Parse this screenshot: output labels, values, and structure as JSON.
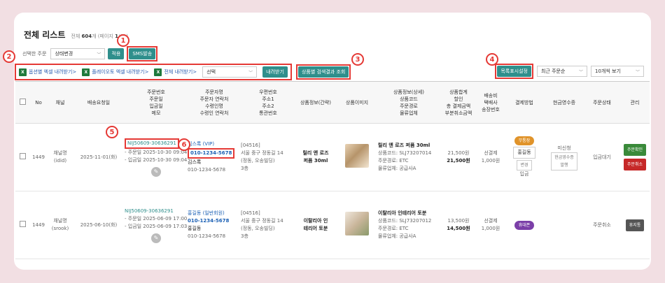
{
  "header": {
    "title": "전체 리스트",
    "count_prefix": "전체",
    "count_total": "604",
    "count_suffix": "개 (페이지",
    "page_current": "1",
    "page_total": "/61)"
  },
  "toolbar": {
    "select_label": "선택한 주문",
    "status_select": "상태변경",
    "apply_label": "적용",
    "sms_label": "SMS발송",
    "export_option": "옵션별 엑셀 내려받기>",
    "export_playauto": "플레이오토 엑셀 내려받기>",
    "export_all": "전체 내려받기>",
    "choose_select": "선택",
    "download_label": "내려받기",
    "search_result_label": "상품별 검색결과 조회",
    "list_settings_label": "목록표시설정",
    "sort_select": "최근 주문순",
    "view_select": "10개씩 보기"
  },
  "markers": [
    "1",
    "2",
    "3",
    "4",
    "5",
    "6"
  ],
  "columns": [
    "No",
    "채널",
    "배송요청일",
    "주문번호\n주문일\n입금일\n메모",
    "주문자명\n주문자 연락처\n수령인명\n수령인 연락처",
    "우편번호\n주소1\n주소2\n통관번호",
    "상품정보(간략)",
    "상품이미지",
    "상품정보(상세)\n상품코드\n주문경로\n물류업체",
    "상품합계\n할인\n총 결제금액\n부분취소금액",
    "배송비\n택배사\n송장번호",
    "결제방법",
    "현금영수증",
    "주문상태",
    "관리"
  ],
  "rows": [
    {
      "no": "1449",
      "channel": "채널명",
      "channel_id": "(idid)",
      "delivery_date": "2025-11-01(화)",
      "order_no": "NIJ50609-30636291",
      "order_date": "- 주문일 2025-10-30 09:04",
      "paid_date": "- 입금일 2025-10-30 09:04",
      "orderer": "김스록",
      "orderer_grade": "(VIP)",
      "orderer_phone": "010-1234-5678",
      "receiver": "김스록",
      "receiver_phone": "010-1234-5678",
      "zip": "[04516]",
      "addr1": "서울 중구 정동길 14",
      "addr2": "(정동, 오송빌딩)",
      "addr3": "3층",
      "product_brief": "릴리 앤 로즈\n퍼퓸 30ml",
      "product_name": "릴리 앤 로즈 퍼퓸 30ml",
      "product_code": "상품코드: SLJ73207014",
      "order_route": "주문경로: ETC",
      "logistics": "물류업체: 공급사A",
      "sum": "21,500원",
      "total": "21,500원",
      "ship_type": "선결제",
      "ship_fee": "1,000원",
      "pay_badge": "무통장",
      "pay_name": "홍길동",
      "pay_change": "변경",
      "pay_status": "입금",
      "receipt_status": "미신청",
      "receipt_btn": "현금영수증\n발행",
      "order_status": "입금대기",
      "action1": "주문확인",
      "action2": "주문취소"
    },
    {
      "no": "1449",
      "channel": "채널명",
      "channel_id": "(srook)",
      "delivery_date": "2025-06-10(화)",
      "order_no": "NIJ50609-30636291",
      "order_date": "- 주문일 2025-06-09 17:00",
      "paid_date": "- 입금일 2025-06-09 17:03",
      "orderer": "홍길동",
      "orderer_grade": "(일반회원)",
      "orderer_phone": "010-1234-5678",
      "receiver": "홍길동",
      "receiver_phone": "010-1234-5678",
      "zip": "[04516]",
      "addr1": "서울 중구 정동길 14",
      "addr2": "(정동, 오송빌딩)",
      "addr3": "3층",
      "product_brief": "이탈리아 인\n테리어 토분",
      "product_name": "이탈리아 인테리어 토분",
      "product_code": "상품코드: SLJ73207012",
      "order_route": "주문경로: ETC",
      "logistics": "물류업체: 공급사A",
      "sum": "13,500원",
      "total": "14,500원",
      "ship_type": "선결제",
      "ship_fee": "1,000원",
      "pay_badge": "휴대폰",
      "order_status": "주문취소",
      "action1": "휴지통"
    }
  ],
  "colors": {
    "accent": "#2f8f8c",
    "marker": "#e53935",
    "confirm": "#3a8a3a",
    "cancel": "#c62828",
    "trash": "#555555",
    "badge_bank": "#e0932a",
    "badge_phone": "#7b3fa8"
  }
}
